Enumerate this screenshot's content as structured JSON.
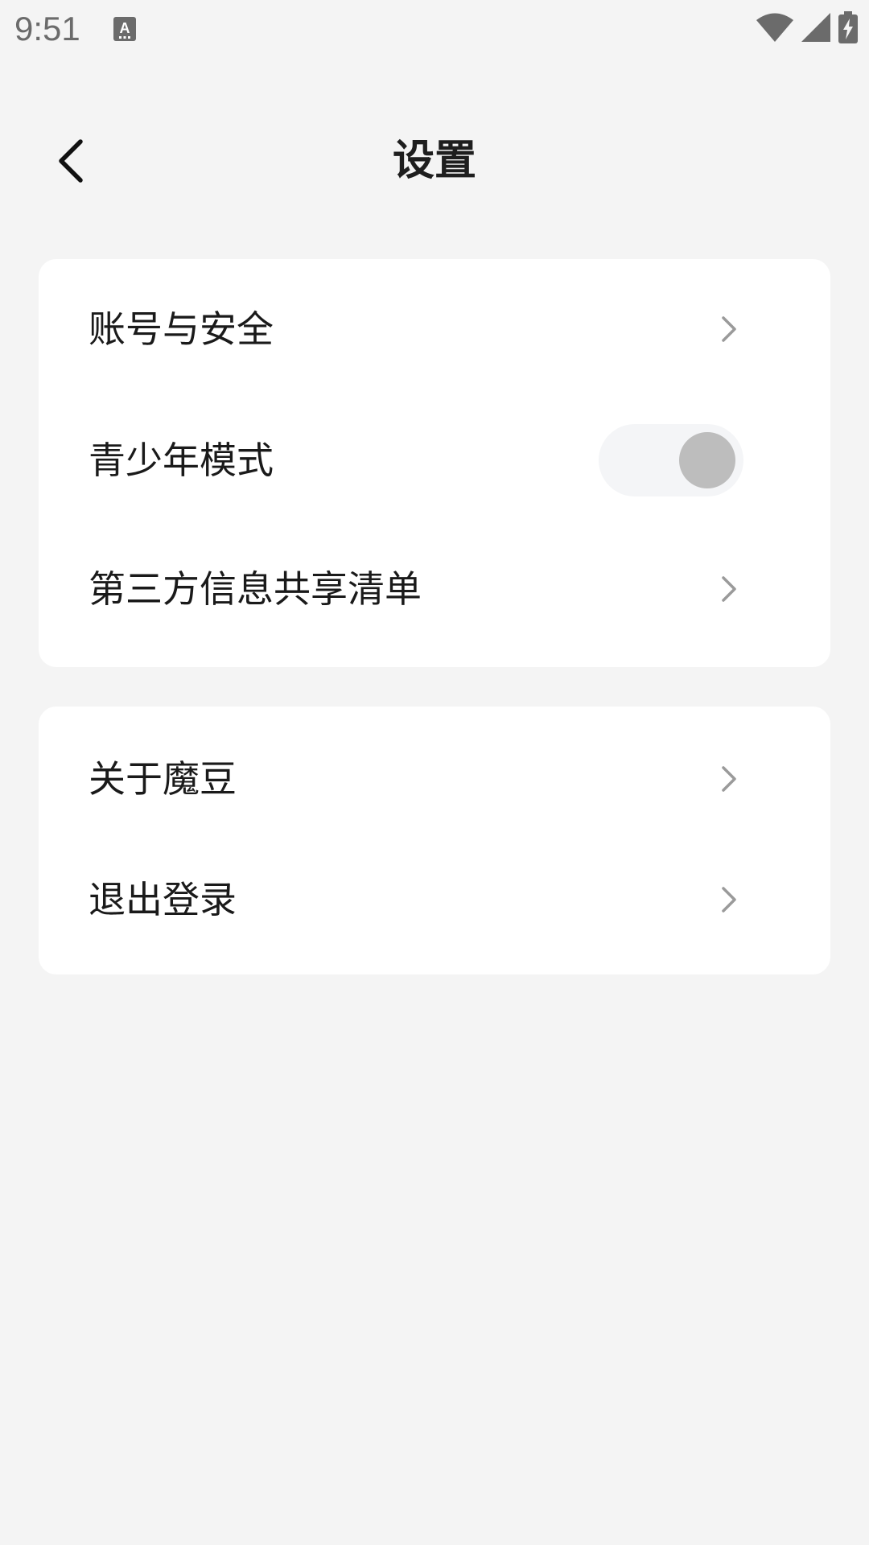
{
  "status_bar": {
    "time": "9:51",
    "icons": [
      "keyboard-a-icon",
      "wifi-icon",
      "signal-icon",
      "battery-charging-icon"
    ]
  },
  "header": {
    "title": "设置",
    "back_icon": "chevron-left-icon"
  },
  "sections": [
    {
      "items": [
        {
          "label": "账号与安全",
          "accessory": "chevron"
        },
        {
          "label": "青少年模式",
          "accessory": "toggle",
          "toggle_on": false
        },
        {
          "label": "第三方信息共享清单",
          "accessory": "chevron"
        }
      ]
    },
    {
      "items": [
        {
          "label": "关于魔豆",
          "accessory": "chevron"
        },
        {
          "label": "退出登录",
          "accessory": "chevron"
        }
      ]
    }
  ],
  "colors": {
    "background": "#f4f4f4",
    "card": "#ffffff",
    "toggle_track": "#f4f5f7",
    "toggle_knob": "#bdbdbd",
    "chevron": "#9a9a9a"
  }
}
